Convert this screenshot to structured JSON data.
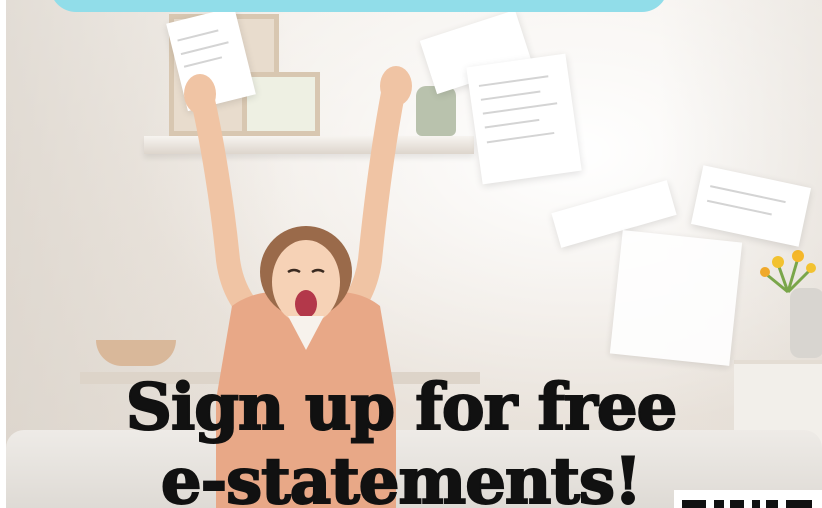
{
  "headline": {
    "line1": "Sign up for free",
    "line2": "e-statements!"
  },
  "colors": {
    "banner": "#91dde9",
    "headline": "#111111",
    "shirt": "#e8a887",
    "background": "#f4f0eb"
  },
  "icons": {
    "qr": "qr-code-icon"
  }
}
